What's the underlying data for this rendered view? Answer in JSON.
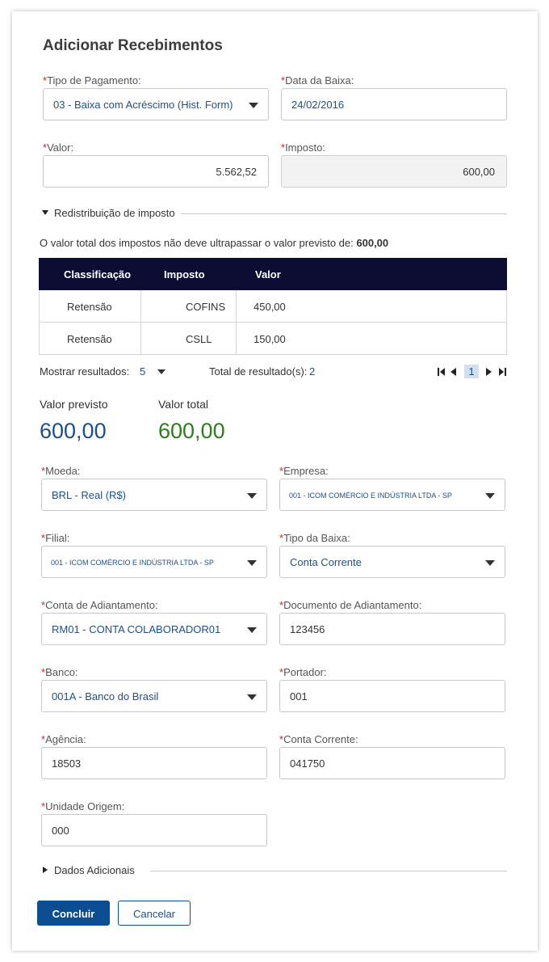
{
  "title": "Adicionar Recebimentos",
  "required_mark": "*",
  "fields": {
    "tipo_pagamento": {
      "label": "Tipo de Pagamento:",
      "value": "03 - Baixa com Acréscimo (Hist. Form)"
    },
    "data_baixa": {
      "label": "Data da Baixa:",
      "value": "24/02/2016"
    },
    "valor": {
      "label": "Valor:",
      "value": "5.562,52"
    },
    "imposto": {
      "label": "Imposto:",
      "value": "600,00"
    },
    "moeda": {
      "label": "Moeda:",
      "value": "BRL - Real (R$)"
    },
    "empresa": {
      "label": "Empresa:",
      "value": "001 - ICOM COMÉRCIO E INDÚSTRIA LTDA - SP"
    },
    "filial": {
      "label": "Filial:",
      "value": "001 - ICOM COMÉRCIO E INDÚSTRIA LTDA - SP"
    },
    "tipo_baixa": {
      "label": "Tipo da Baixa:",
      "value": "Conta Corrente"
    },
    "conta_adiantamento": {
      "label": "Conta de Adiantamento:",
      "value": "RM01 - CONTA COLABORADOR01"
    },
    "documento_adiantamento": {
      "label": "Documento de Adiantamento:",
      "value": "123456"
    },
    "banco": {
      "label": "Banco:",
      "value": "001A - Banco do Brasil"
    },
    "portador": {
      "label": "Portador:",
      "value": "001"
    },
    "agencia": {
      "label": "Agência:",
      "value": "18503"
    },
    "conta_corrente": {
      "label": "Conta Corrente:",
      "value": "041750"
    },
    "unidade_origem": {
      "label": "Unidade Origem:",
      "value": "000"
    }
  },
  "redistribuicao": {
    "title": "Redistribuição de imposto",
    "note_text": "O valor total dos impostos não deve ultrapassar o valor previsto de: ",
    "note_value": "600,00",
    "columns": [
      "Classificação",
      "Imposto",
      "Valor"
    ],
    "rows": [
      [
        "Retensão",
        "COFINS",
        "450,00"
      ],
      [
        "Retensão",
        "CSLL",
        "150,00"
      ]
    ],
    "pager": {
      "show_label": "Mostrar resultados:",
      "page_size": "5",
      "total_label": "Total de resultado(s):",
      "total": "2",
      "current_page": "1"
    }
  },
  "summary": {
    "previsto_label": "Valor previsto",
    "previsto_value": "600,00",
    "total_label": "Valor total",
    "total_value": "600,00",
    "previsto_color": "#1b4f8a",
    "total_color": "#2e7d1c"
  },
  "dados_adicionais": {
    "title": "Dados Adicionais"
  },
  "buttons": {
    "concluir": "Concluir",
    "cancelar": "Cancelar"
  },
  "colors": {
    "accent": "#0a4d92",
    "header_bg": "#0d0d33",
    "required": "#c0262d"
  }
}
